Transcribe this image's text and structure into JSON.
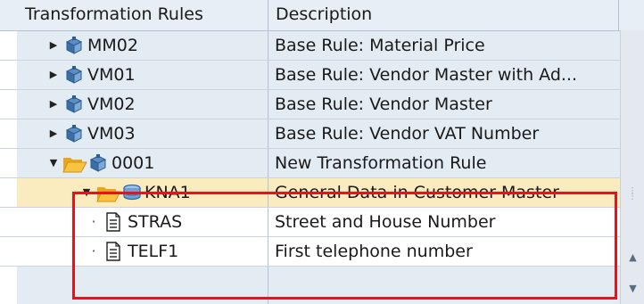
{
  "columns": {
    "col1": "Transformation Rules",
    "col2": "Description"
  },
  "rows": [
    {
      "label": "MM02",
      "description": "Base Rule: Material Price",
      "node": "collapsed",
      "icon": "rule-icon"
    },
    {
      "label": "VM01",
      "description": "Base Rule: Vendor Master with Ad...",
      "node": "collapsed",
      "icon": "rule-icon"
    },
    {
      "label": "VM02",
      "description": "Base Rule: Vendor Master",
      "node": "collapsed",
      "icon": "rule-icon"
    },
    {
      "label": "VM03",
      "description": "Base Rule: Vendor VAT Number",
      "node": "collapsed",
      "icon": "rule-icon"
    },
    {
      "label": "0001",
      "description": "New Transformation Rule",
      "node": "expanded",
      "icon": "folder-open-icon"
    },
    {
      "label": "KNA1",
      "description": "General Data in Customer Master",
      "node": "expanded",
      "icon": "table-icon"
    },
    {
      "label": "STRAS",
      "description": "Street and House Number",
      "node": "leaf",
      "icon": "document-icon"
    },
    {
      "label": "TELF1",
      "description": "First telephone number",
      "node": "leaf",
      "icon": "document-icon"
    }
  ],
  "colors": {
    "header_bg": "#e8eef5",
    "stripe_bg": "#e3ebf3",
    "selected_bg": "#fbecc0",
    "highlight_border": "#e3141b",
    "folder": "#f5b82e",
    "rule_icon": "#3a6ea5"
  }
}
